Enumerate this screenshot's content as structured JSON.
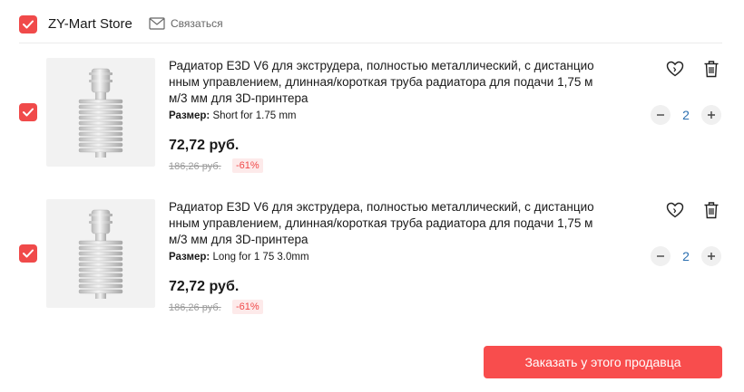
{
  "store": {
    "name": "ZY-Mart Store",
    "contact_label": "Связаться"
  },
  "items": [
    {
      "title": "Радиатор E3D V6 для экструдера, полностью металлический, с дистанционным управлением, длинная/короткая труба радиатора для подачи 1,75 мм/3 мм для 3D-принтера",
      "size_label": "Размер:",
      "size_value": " Short for 1.75 mm",
      "price": "72,72 руб.",
      "old_price": "186,26 руб.",
      "discount": "-61%",
      "quantity": "2",
      "checked": true
    },
    {
      "title": "Радиатор E3D V6 для экструдера, полностью металлический, с дистанционным управлением, длинная/короткая труба радиатора для подачи 1,75 мм/3 мм для 3D-принтера",
      "size_label": "Размер:",
      "size_value": " Long for 1 75 3.0mm",
      "price": "72,72 руб.",
      "old_price": "186,26 руб.",
      "discount": "-61%",
      "quantity": "2",
      "checked": true
    }
  ],
  "order_button_label": "Заказать у этого продавца",
  "colors": {
    "accent": "#f84d4d",
    "checkbox": "#f04a4a",
    "quantity_text": "#2b6fb0"
  },
  "icons": {
    "checkbox": "check-icon",
    "contact": "mail-icon",
    "wishlist": "heart-icon",
    "delete": "trash-icon",
    "decrease": "minus-icon",
    "increase": "plus-icon"
  }
}
